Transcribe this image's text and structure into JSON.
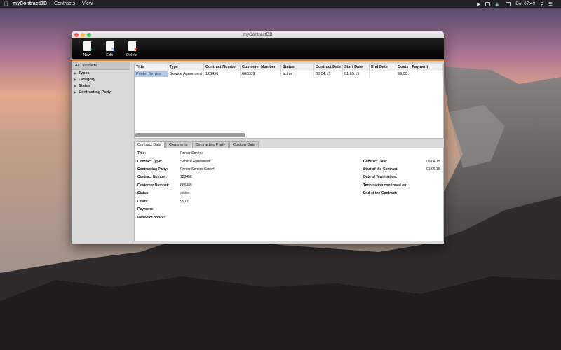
{
  "menubar": {
    "apple": "",
    "app_name": "myContractDB",
    "menus": [
      "Contracts",
      "View"
    ],
    "clock": "Do. 07:49"
  },
  "window": {
    "title": "myContractDB",
    "toolbar": [
      {
        "label": "New",
        "icon": "document-add-icon"
      },
      {
        "label": "Edit",
        "icon": "document-edit-icon"
      },
      {
        "label": "Delete",
        "icon": "document-delete-icon"
      }
    ]
  },
  "sidebar": {
    "header": "All Contracts",
    "items": [
      "Types",
      "Category",
      "Status",
      "Contracting Party"
    ]
  },
  "table": {
    "columns": [
      "Title",
      "Type",
      "Contract Number",
      "Customer Number",
      "Status",
      "Contract Date",
      "Start Date",
      "End Date",
      "Costs",
      "Payment"
    ],
    "rows": [
      [
        "Printer Service",
        "Service Agreement",
        "123456",
        "666889",
        "active",
        "08.04.15",
        "01.05.15",
        "",
        "99,00",
        ""
      ]
    ]
  },
  "tabs": [
    "Contract Data",
    "Comments",
    "Contracting Party",
    "Custom Data"
  ],
  "detail": {
    "left": [
      {
        "label": "Title:",
        "value": "Printer Service"
      },
      {
        "label": "Contract Type:",
        "value": "Service Agreement"
      },
      {
        "label": "Contracting Party:",
        "value": "Printer Service GmbH"
      },
      {
        "label": "Contract  Number:",
        "value": "123456"
      },
      {
        "label": "Customer  Number:",
        "value": "666889"
      },
      {
        "label": "Status:",
        "value": "active"
      },
      {
        "label": "Costs:",
        "value": "99,00"
      },
      {
        "label": "Payment:",
        "value": ""
      },
      {
        "label": "Period of notice:",
        "value": ""
      }
    ],
    "right": [
      {
        "label": "Contract Date:",
        "value": "08.04.15"
      },
      {
        "label": "Start of the Contract:",
        "value": "01.05.15"
      },
      {
        "label": "Date of Termination:",
        "value": ""
      },
      {
        "label": "Termination confirmed on:",
        "value": ""
      },
      {
        "label": "End of the Contract:",
        "value": ""
      }
    ]
  },
  "colors": {
    "toolbar_accent": "#e07a1f",
    "selection": "#b4c8e3"
  }
}
